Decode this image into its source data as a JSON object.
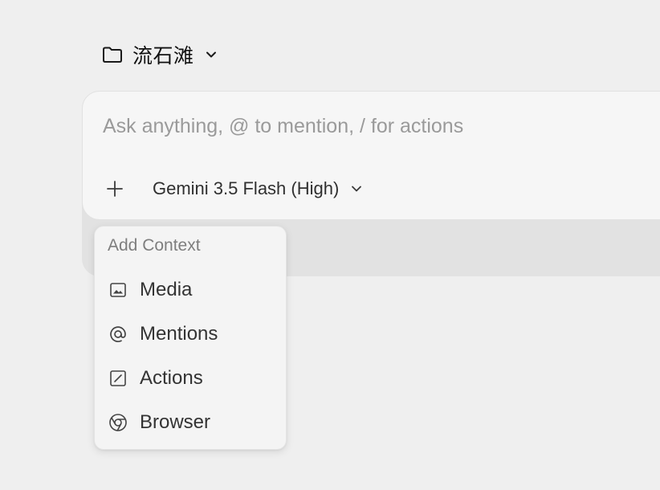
{
  "workspace": {
    "name": "流石滩",
    "icon": "folder-icon"
  },
  "composer": {
    "placeholder": "Ask anything, @ to mention, / for actions",
    "model_label": "Gemini 3.5 Flash (High)",
    "add_icon": "plus-icon"
  },
  "menu": {
    "header": "Add Context",
    "items": [
      {
        "label": "Media",
        "icon": "image-icon"
      },
      {
        "label": "Mentions",
        "icon": "at-icon"
      },
      {
        "label": "Actions",
        "icon": "slash-icon"
      },
      {
        "label": "Browser",
        "icon": "chrome-icon"
      }
    ]
  }
}
